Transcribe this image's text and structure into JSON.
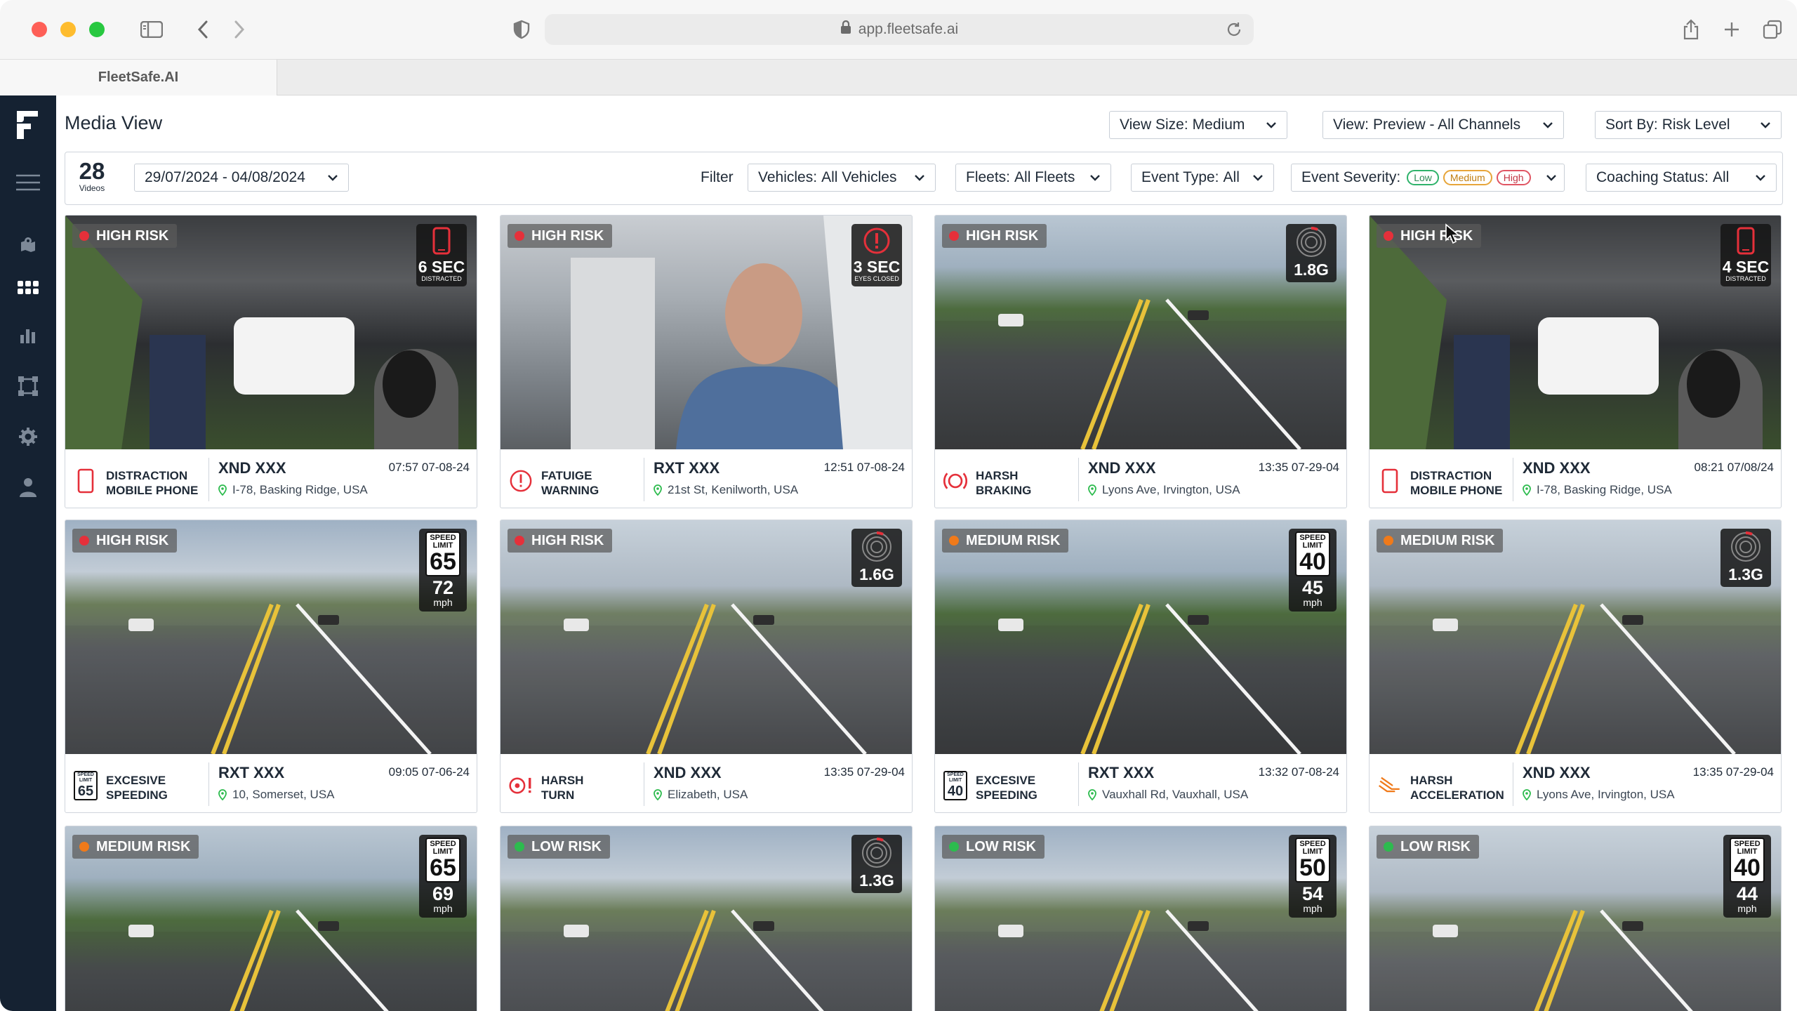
{
  "browser": {
    "url": "app.fleetsafe.ai",
    "tab_title": "FleetSafe.AI"
  },
  "header": {
    "title": "Media View",
    "view_size": {
      "label": "View Size:",
      "value": "Medium"
    },
    "view_mode": {
      "label": "View:",
      "value": "Preview - All Channels"
    },
    "sort": {
      "label": "Sort By:",
      "value": "Risk Level"
    }
  },
  "filters": {
    "count": "28",
    "count_unit": "Videos",
    "date_range": "29/07/2024 - 04/08/2024",
    "filter_label": "Filter",
    "vehicles": {
      "label": "Vehicles:",
      "value": "All Vehicles"
    },
    "fleets": {
      "label": "Fleets:",
      "value": "All Fleets"
    },
    "event_type": {
      "label": "Event Type:",
      "value": "All"
    },
    "severity": {
      "label": "Event Severity:",
      "low": "Low",
      "medium": "Medium",
      "high": "High"
    },
    "coaching": {
      "label": "Coaching Status:",
      "value": "All"
    }
  },
  "colors": {
    "high": "#e5303a",
    "medium": "#f07a1a",
    "low": "#2dbb4e",
    "sidebar": "#152232"
  },
  "cards": [
    {
      "risk": "HIGH RISK",
      "level": "high",
      "badge": {
        "kind": "phone",
        "value": "6 SEC",
        "sub": "DISTRACTED"
      },
      "event_icon": "phone-icon",
      "event": "DISTRACTION\nMOBILE PHONE",
      "vehicle": "XND XXX",
      "time": "07:57 07-08-24",
      "location": "I-78, Basking Ridge, USA",
      "scene": "cabin"
    },
    {
      "risk": "HIGH RISK",
      "level": "high",
      "badge": {
        "kind": "alert",
        "value": "3 SEC",
        "sub": "EYES CLOSED"
      },
      "event_icon": "alert-icon",
      "event": "FATUIGE\nWARNING",
      "vehicle": "RXT XXX",
      "time": "12:51 07-08-24",
      "location": "21st St, Kenilworth, USA",
      "scene": "driver"
    },
    {
      "risk": "HIGH RISK",
      "level": "high",
      "badge": {
        "kind": "gforce",
        "value": "1.8G",
        "sub": ""
      },
      "event_icon": "braking-icon",
      "event": "HARSH\nBRAKING",
      "vehicle": "XND XXX",
      "time": "13:35 07-29-04",
      "location": "Lyons Ave, Irvington, USA",
      "scene": "street"
    },
    {
      "risk": "HIGH RISK",
      "level": "high",
      "badge": {
        "kind": "phone",
        "value": "4 SEC",
        "sub": "DISTRACTED"
      },
      "event_icon": "phone-icon",
      "event": "DISTRACTION\nMOBILE PHONE",
      "vehicle": "XND XXX",
      "time": "08:21 07/08/24",
      "location": "I-78, Basking Ridge, USA",
      "scene": "cabin"
    },
    {
      "risk": "HIGH RISK",
      "level": "high",
      "badge": {
        "kind": "speed",
        "limit": "65",
        "value": "72",
        "sub": "mph",
        "sign_text": "SPEED LIMIT"
      },
      "event_icon": "speed-sign-icon",
      "event_sign": "65",
      "event_sign_text": "SPEED LIMIT",
      "event": "EXCESIVE\nSPEEDING",
      "vehicle": "RXT XXX",
      "time": "09:05 07-06-24",
      "location": "10, Somerset, USA",
      "scene": "highway"
    },
    {
      "risk": "HIGH RISK",
      "level": "high",
      "badge": {
        "kind": "gforce",
        "value": "1.6G",
        "sub": ""
      },
      "event_icon": "turn-icon",
      "event": "HARSH\nTURN",
      "vehicle": "XND XXX",
      "time": "13:35 07-29-04",
      "location": "Elizabeth, USA",
      "scene": "road"
    },
    {
      "risk": "MEDIUM RISK",
      "level": "medium",
      "badge": {
        "kind": "speed",
        "limit": "40",
        "value": "45",
        "sub": "mph",
        "sign_text": "SPEED LIMIT"
      },
      "event_icon": "speed-sign-icon",
      "event_sign": "40",
      "event_sign_text": "SPEED LIMIT",
      "event": "EXCESIVE\nSPEEDING",
      "vehicle": "RXT XXX",
      "time": "13:32 07-08-24",
      "location": "Vauxhall Rd, Vauxhall, USA",
      "scene": "street"
    },
    {
      "risk": "MEDIUM RISK",
      "level": "medium",
      "badge": {
        "kind": "gforce",
        "value": "1.3G",
        "sub": ""
      },
      "event_icon": "acceleration-icon",
      "event": "HARSH\nACCELERATION",
      "vehicle": "XND XXX",
      "time": "13:35 07-29-04",
      "location": "Lyons Ave, Irvington, USA",
      "scene": "road"
    },
    {
      "risk": "MEDIUM RISK",
      "level": "medium",
      "badge": {
        "kind": "speed",
        "limit": "65",
        "value": "69",
        "sub": "mph",
        "sign_text": "SPEED LIMIT"
      },
      "scene": "street"
    },
    {
      "risk": "LOW RISK",
      "level": "low",
      "badge": {
        "kind": "gforce",
        "value": "1.3G",
        "sub": ""
      },
      "scene": "highway"
    },
    {
      "risk": "LOW RISK",
      "level": "low",
      "badge": {
        "kind": "speed",
        "limit": "50",
        "value": "54",
        "sub": "mph",
        "sign_text": "SPEED LIMIT"
      },
      "scene": "highway"
    },
    {
      "risk": "LOW RISK",
      "level": "low",
      "badge": {
        "kind": "speed",
        "limit": "40",
        "value": "44",
        "sub": "mph",
        "sign_text": "SPEED LIMIT"
      },
      "scene": "road"
    }
  ]
}
